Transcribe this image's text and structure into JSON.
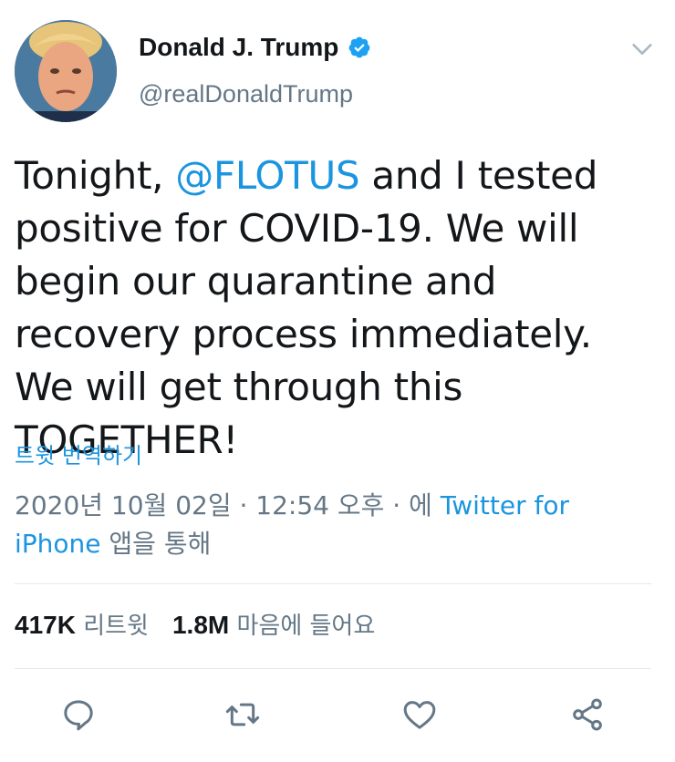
{
  "user": {
    "display_name": "Donald J. Trump",
    "handle": "@realDonaldTrump",
    "verified": true
  },
  "tweet": {
    "text_before": "Tonight, ",
    "mention": "@FLOTUS",
    "text_after": " and I tested positive for COVID-19. We will begin our quarantine and recovery process immediately. We will get through this TOGETHER!"
  },
  "translate_label": "트윗 번역하기",
  "meta": {
    "timestamp": "2020년 10월 02일 · 12:54 오후 · 에 ",
    "source": "Twitter for iPhone",
    "source_suffix": " 앱을 통해"
  },
  "stats": {
    "retweets_count": "417K",
    "retweets_label": "리트윗",
    "likes_count": "1.8M",
    "likes_label": "마음에 들어요"
  },
  "colors": {
    "accent": "#1b95e0",
    "secondary_text": "#657786",
    "primary_text": "#14171a",
    "divider": "#e1e8ed"
  },
  "icons": [
    "verified-badge-icon",
    "chevron-down-icon",
    "reply-icon",
    "retweet-icon",
    "like-icon",
    "share-icon"
  ]
}
